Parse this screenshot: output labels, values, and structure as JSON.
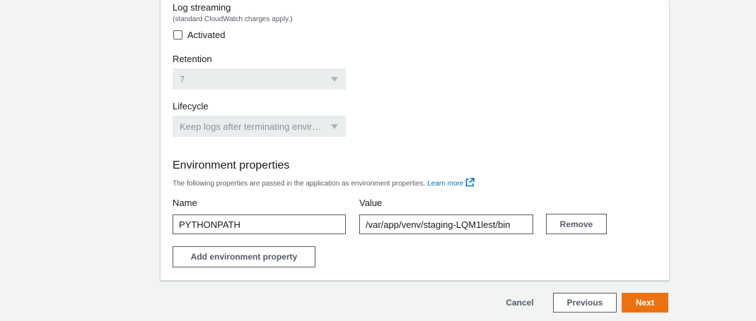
{
  "log_streaming": {
    "title": "Log streaming",
    "description": "(standard CloudWatch charges apply.)",
    "checkbox_label": "Activated",
    "checked": false
  },
  "retention": {
    "label": "Retention",
    "value": "7"
  },
  "lifecycle": {
    "label": "Lifecycle",
    "value": "Keep logs after terminating environment"
  },
  "env_properties": {
    "heading": "Environment properties",
    "description": "The following properties are passed in the application as environment properties.",
    "learn_more": "Learn more",
    "name_header": "Name",
    "value_header": "Value",
    "rows": [
      {
        "name": "PYTHONPATH",
        "value": "/var/app/venv/staging-LQM1lest/bin",
        "remove_label": "Remove"
      }
    ],
    "add_label": "Add environment property"
  },
  "footer": {
    "cancel": "Cancel",
    "previous": "Previous",
    "next": "Next"
  },
  "colors": {
    "primary": "#ec7211",
    "link": "#0073bb",
    "background": "#f2f3f3"
  }
}
